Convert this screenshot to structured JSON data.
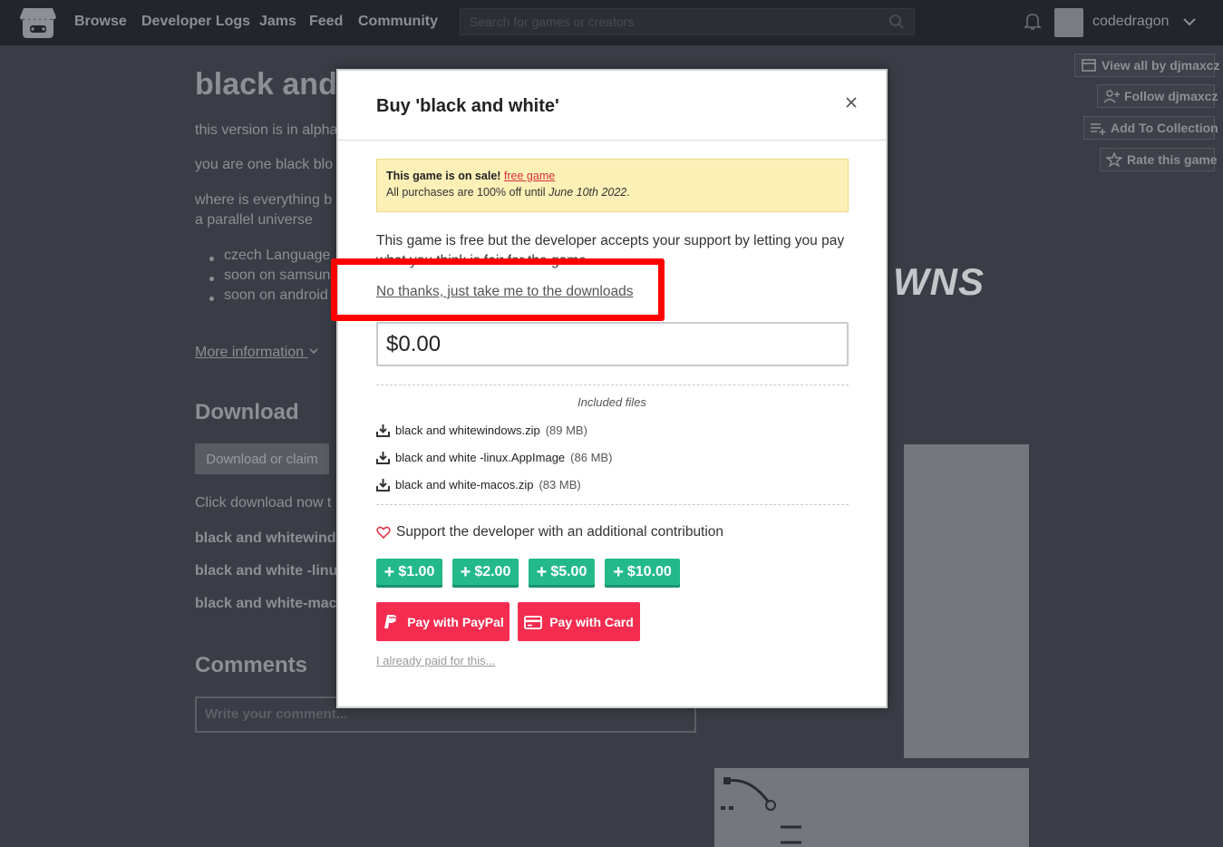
{
  "nav": {
    "links": [
      "Browse",
      "Developer Logs",
      "Jams",
      "Feed",
      "Community"
    ],
    "search_placeholder": "Search for games or creators",
    "username": "codedragon"
  },
  "side_actions": {
    "view_all": "View all by djmaxcz",
    "follow": "Follow djmaxcz",
    "add_collection": "Add To Collection",
    "rate": "Rate this game"
  },
  "page": {
    "title": "black and",
    "p1": "this version is in alpha",
    "p2": "you are one black blo",
    "p3a": "where is everything b",
    "p3b": "a parallel universe",
    "li1": "czech  Language",
    "li2": "soon on samsun",
    "li3": "soon  on android",
    "more_info": "More information",
    "download_heading": "Download",
    "download_button": "Download or claim",
    "click_download": "Click download now t",
    "file1": "black and whitewind",
    "file2": "black and white -linu",
    "file3": "black and white-mac",
    "comments_heading": "Comments",
    "comment_placeholder": "Write your comment...",
    "banner_text": "WNS"
  },
  "modal": {
    "title": "Buy 'black and white'",
    "sale": {
      "lead": "This game is on sale!",
      "link": "free game",
      "line2_prefix": "All purchases are 100% off until",
      "date": "June 10th 2022",
      "suffix": "."
    },
    "description": "This game is free but the developer accepts your support by letting you pay what you think is fair for the game.",
    "no_thanks": "No thanks, just take me to the downloads",
    "price": "$0.00",
    "included_files_label": "Included files",
    "files": [
      {
        "name": "black and whitewindows.zip",
        "size": "(89 MB)"
      },
      {
        "name": "black and white -linux.AppImage",
        "size": "(86 MB)"
      },
      {
        "name": "black and white-macos.zip",
        "size": "(83 MB)"
      }
    ],
    "support_text": "Support the developer with an additional contribution",
    "amounts": [
      "$1.00",
      "$2.00",
      "$5.00",
      "$10.00"
    ],
    "paypal_label": "Pay with PayPal",
    "card_label": "Pay with Card",
    "already_paid": "I already paid for this..."
  },
  "colors": {
    "accent_green": "#23b98b",
    "pay_red": "#f42d50",
    "highlight_red": "#ff0000",
    "sale_bg": "#fdf0b7"
  }
}
